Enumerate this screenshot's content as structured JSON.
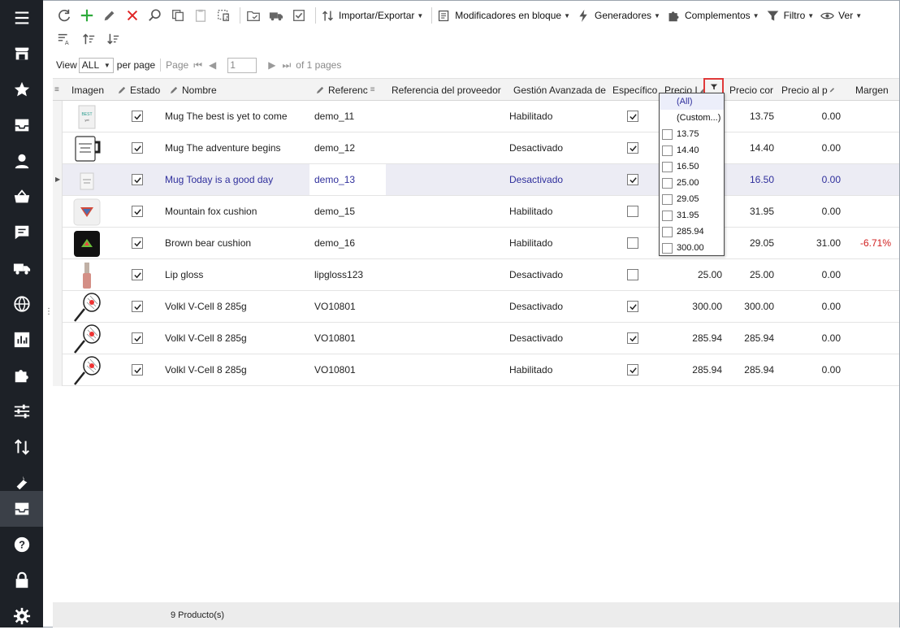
{
  "sidebar": {
    "items": [
      {
        "icon": "menu-icon"
      },
      {
        "icon": "store-icon"
      },
      {
        "icon": "star-icon"
      },
      {
        "icon": "inbox-icon"
      },
      {
        "icon": "user-icon"
      },
      {
        "icon": "basket-icon"
      },
      {
        "icon": "chat-icon"
      },
      {
        "icon": "truck-icon"
      },
      {
        "icon": "globe-icon"
      },
      {
        "icon": "stats-icon"
      },
      {
        "icon": "puzzle-icon"
      },
      {
        "icon": "sliders-icon"
      },
      {
        "icon": "import-export-icon"
      },
      {
        "icon": "wrench-icon"
      },
      {
        "icon": "catalog-icon",
        "active": true
      },
      {
        "icon": "help-icon"
      },
      {
        "icon": "lock-icon"
      },
      {
        "icon": "settings-icon"
      }
    ]
  },
  "toolbar": {
    "menus": {
      "import_export": "Importar/Exportar",
      "bulk_modifiers": "Modificadores en bloque",
      "generators": "Generadores",
      "addons": "Complementos",
      "filter": "Filtro",
      "view": "Ver"
    }
  },
  "pager": {
    "view_label": "View",
    "view_value": "ALL",
    "per_page": "per page",
    "page_label": "Page",
    "page_value": "1",
    "of_pages": "of 1 pages"
  },
  "grid": {
    "columns": {
      "image": "Imagen",
      "status": "Estado",
      "name": "Nombre",
      "reference": "Referenc",
      "supplier_ref": "Referencia del proveedor",
      "advanced": "Gestión Avanzada de",
      "specific": "Específico",
      "price": "Precio I",
      "price_with": "Precio cor",
      "price_unit": "Precio al p",
      "margin": "Margen"
    },
    "rows": [
      {
        "name": "Mug The best is yet to come",
        "ref": "demo_11",
        "advanced": "Habilitado",
        "specific": true,
        "price": "",
        "price_with": "13.75",
        "unit": "0.00",
        "margin": ""
      },
      {
        "name": "Mug The adventure begins",
        "ref": "demo_12",
        "advanced": "Desactivado",
        "specific": true,
        "price": "",
        "price_with": "14.40",
        "unit": "0.00",
        "margin": ""
      },
      {
        "name": "Mug Today is a good day",
        "ref": "demo_13",
        "advanced": "Desactivado",
        "specific": true,
        "price": "",
        "price_with": "16.50",
        "unit": "0.00",
        "margin": "",
        "selected": true
      },
      {
        "name": "Mountain fox cushion",
        "ref": "demo_15",
        "advanced": "Habilitado",
        "specific": false,
        "price": "",
        "price_with": "31.95",
        "unit": "0.00",
        "margin": ""
      },
      {
        "name": "Brown bear cushion",
        "ref": "demo_16",
        "advanced": "Habilitado",
        "specific": false,
        "price": "",
        "price_with": "29.05",
        "unit": "31.00",
        "margin": "-6.71%"
      },
      {
        "name": "Lip gloss",
        "ref": "lipgloss123",
        "advanced": "Desactivado",
        "specific": false,
        "price": "25.00",
        "price_with": "25.00",
        "unit": "0.00",
        "margin": ""
      },
      {
        "name": "Volkl V-Cell 8 285g",
        "ref": "VO10801",
        "advanced": "Desactivado",
        "specific": true,
        "price": "300.00",
        "price_with": "300.00",
        "unit": "0.00",
        "margin": ""
      },
      {
        "name": "Volkl V-Cell 8 285g",
        "ref": "VO10801",
        "advanced": "Desactivado",
        "specific": true,
        "price": "285.94",
        "price_with": "285.94",
        "unit": "0.00",
        "margin": ""
      },
      {
        "name": "Volkl V-Cell 8 285g",
        "ref": "VO10801",
        "advanced": "Habilitado",
        "specific": true,
        "price": "285.94",
        "price_with": "285.94",
        "unit": "0.00",
        "margin": ""
      }
    ]
  },
  "filter_popup": {
    "all": "(All)",
    "custom": "(Custom...)",
    "values": [
      "13.75",
      "14.40",
      "16.50",
      "25.00",
      "29.05",
      "31.95",
      "285.94",
      "300.00"
    ]
  },
  "status_bar": {
    "count": "9 Producto(s)"
  },
  "colors": {
    "sidebar_bg": "#1d2127",
    "selected_text": "#2f2f9c",
    "negative": "#d12020",
    "highlight_border": "#e03a3a"
  }
}
